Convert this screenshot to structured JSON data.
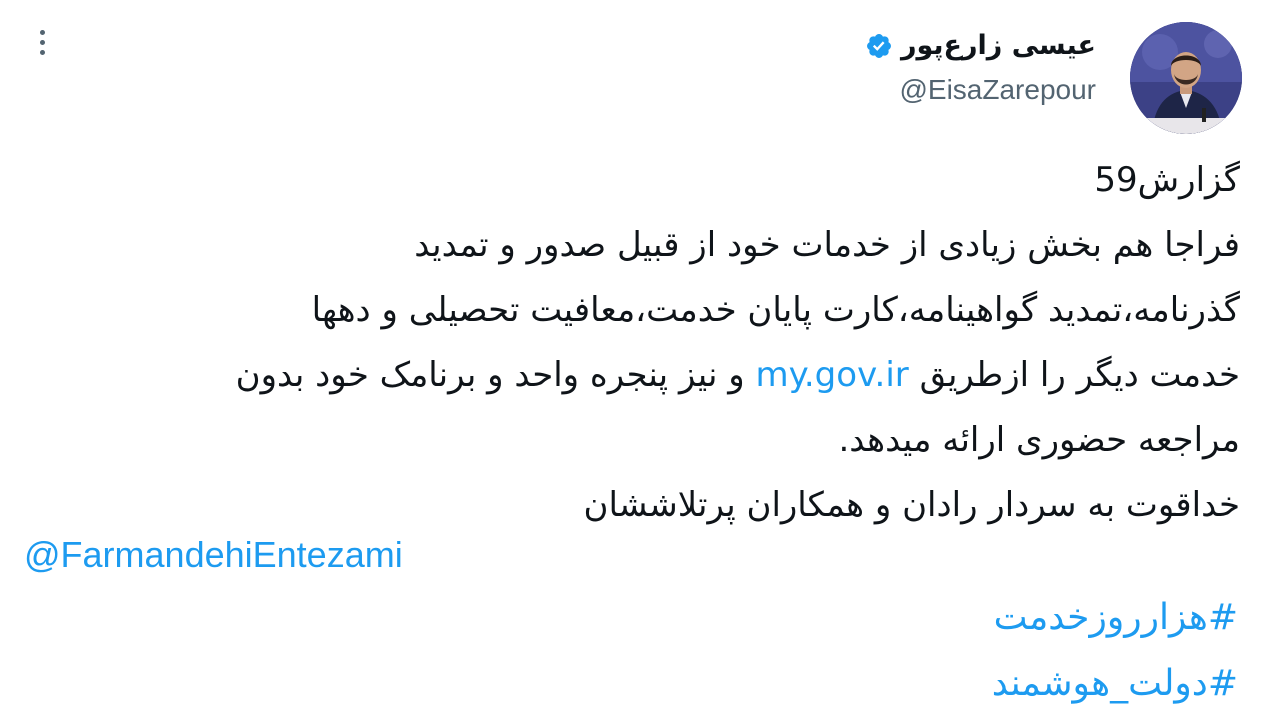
{
  "author": {
    "display_name": "عیسی زارع‌پور",
    "handle": "@EisaZarepour",
    "verified": true,
    "verified_icon": "verified-badge-icon",
    "avatar": "profile-photo"
  },
  "menu": {
    "icon": "more-options-icon"
  },
  "tweet": {
    "line_1": "گزارش59",
    "line_2": "فراجا هم بخش زیادی از خدمات خود از قبیل صدور و تمدید",
    "line_3": "گذرنامه،تمدید گواهینامه،کارت پایان خدمت،معافیت تحصیلی و دهها",
    "line_4_before_link": "خدمت دیگر را ازطریق ",
    "link_text": "my.gov.ir",
    "line_4_after_link": " و نیز پنجره واحد و برنامک خود بدون",
    "line_5": "مراجعه حضوری ارائه میدهد.",
    "line_6": "خداقوت به سردار رادان و همکاران پرتلاششان",
    "mention": "@FarmandehiEntezami",
    "hashtags": [
      "#هزارروزخدمت",
      "#دولت_هوشمند"
    ]
  },
  "colors": {
    "link": "#1d9bf0",
    "text": "#0f1419",
    "secondary": "#536471"
  }
}
